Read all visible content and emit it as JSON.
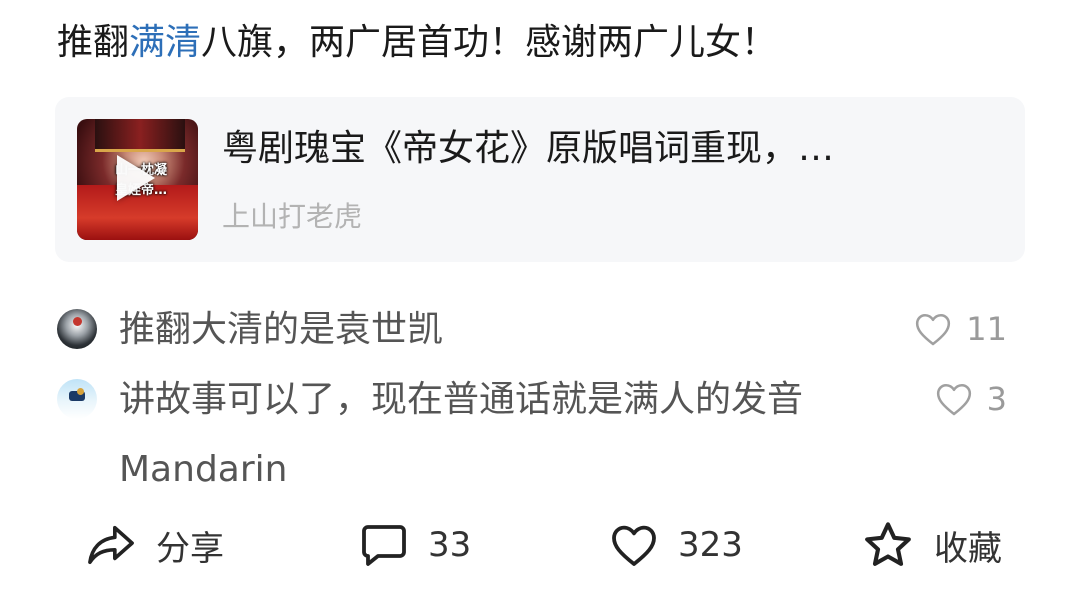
{
  "post": {
    "title_before": "推翻",
    "title_highlight": "满清",
    "title_after": "八旗，两广居首功！感谢两广儿女！",
    "highlight_color": "#2d6fb8"
  },
  "video_card": {
    "title": "粤剧瑰宝《帝女花》原版唱词重现，…",
    "author": "上山打老虎",
    "thumbnail_overlay_lines": [
      "山一枕凝",
      "皇姪帝…"
    ],
    "play_icon": "play-icon"
  },
  "comments": [
    {
      "text": "推翻大清的是袁世凯",
      "likes": "11"
    },
    {
      "text": "讲故事可以了，现在普通话就是满人的发音Mandarin",
      "likes": "3"
    }
  ],
  "actions": {
    "share": "分享",
    "comments": "33",
    "likes": "323",
    "favorite": "收藏"
  },
  "icons": {
    "share": "share-icon",
    "comment": "comment-icon",
    "like": "heart-icon",
    "favorite": "star-icon"
  }
}
